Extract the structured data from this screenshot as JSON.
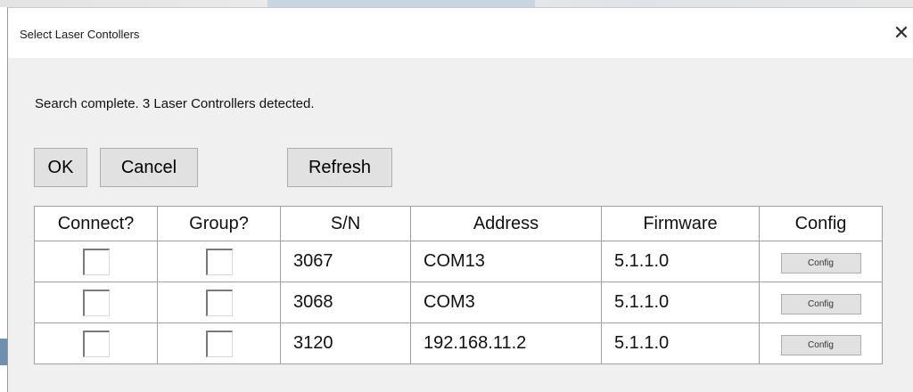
{
  "window": {
    "title": "Select Laser Contollers",
    "close_glyph": "✕"
  },
  "status_text": "Search complete.  3 Laser Controllers detected.",
  "buttons": {
    "ok": "OK",
    "cancel": "Cancel",
    "refresh": "Refresh"
  },
  "table": {
    "headers": [
      "Connect?",
      "Group?",
      "S/N",
      "Address",
      "Firmware",
      "Config"
    ],
    "rows": [
      {
        "connect": false,
        "group": false,
        "sn": "3067",
        "address": "COM13",
        "firmware": "5.1.1.0",
        "config_label": "Config"
      },
      {
        "connect": false,
        "group": false,
        "sn": "3068",
        "address": "COM3",
        "firmware": "5.1.1.0",
        "config_label": "Config"
      },
      {
        "connect": false,
        "group": false,
        "sn": "3120",
        "address": "192.168.11.2",
        "firmware": "5.1.1.0",
        "config_label": "Config"
      }
    ]
  },
  "colors": {
    "dialog_bg": "#f0f0f0",
    "button_bg": "#e1e1e1",
    "grid_line": "#a0a0a0"
  }
}
